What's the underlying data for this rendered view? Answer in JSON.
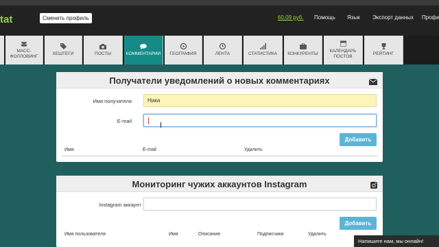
{
  "header": {
    "logo": "tat",
    "profile_button": "Сменить профиль",
    "balance": "60,09 руб.",
    "menu": [
      "Помощь",
      "Язык",
      "Экспорт данных",
      "Профи"
    ]
  },
  "nav": {
    "tabs": [
      {
        "label": "МАСС-\nФОЛЛОВИНГ",
        "icon": "users-icon"
      },
      {
        "label": "ХЕШТЕГИ",
        "icon": "tags-icon"
      },
      {
        "label": "ПОСТЫ",
        "icon": "camera-icon"
      },
      {
        "label": "КОММЕНТАРИИ",
        "icon": "comment-icon",
        "active": true
      },
      {
        "label": "ГЕОГРАФИЯ",
        "icon": "compass-icon"
      },
      {
        "label": "ЛЕНТА",
        "icon": "clock-icon"
      },
      {
        "label": "СТАТИСТИКА",
        "icon": "signal-icon"
      },
      {
        "label": "КОНКУРЕНТЫ",
        "icon": "briefcase-icon"
      },
      {
        "label": "КАЛЕНДАРЬ\nПОСТОВ",
        "icon": "calendar-icon"
      },
      {
        "label": "РЕЙТИНГ",
        "icon": "trophy-icon"
      }
    ]
  },
  "notify_panel": {
    "title": "Получатели уведомлений о новых комментариях",
    "name_label": "Имя получателя",
    "name_value": "Ника",
    "email_label": "E-mail",
    "email_value": "",
    "add_button": "Добавить",
    "columns": [
      "Имя",
      "E-mail",
      "Удалить"
    ]
  },
  "monitor_panel": {
    "title": "Мониторинг чужих аккаунтов Instagram",
    "account_label": "Instagram аккаунт",
    "account_value": "",
    "add_button": "Добавить",
    "columns": [
      "Имя пользователя",
      "Имя",
      "Описание",
      "Подписчики",
      "Удалить"
    ]
  },
  "chat": {
    "text": "Напишите нам, мы онлайн!"
  },
  "colors": {
    "accent": "#138c87",
    "background": "#1f5f5e",
    "button": "#5bb4d8",
    "balance": "#8fd14f"
  }
}
